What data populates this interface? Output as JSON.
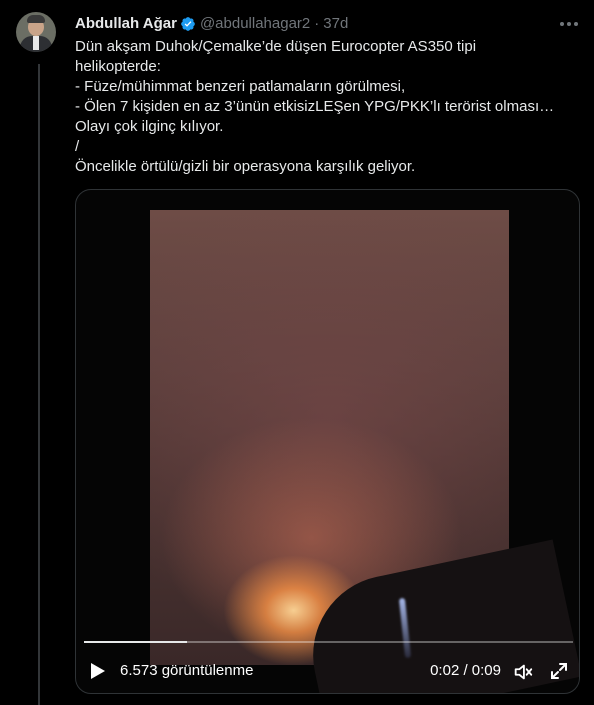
{
  "tweet": {
    "author_name": "Abdullah Ağar",
    "handle": "@abdullahagar2",
    "separator": "·",
    "time": "37d",
    "text_lines": [
      "Dün akşam Duhok/Çemalke’de düşen Eurocopter AS350 tipi",
      "helikopterde:",
      "- Füze/mühimmat benzeri patlamaların görülmesi,",
      "- Ölen 7 kişiden en az 3’ünün etkisizLEŞen YPG/PKK’lı terörist olması…",
      "Olayı çok ilginç kılıyor.",
      "/",
      "Öncelikle örtülü/gizli bir operasyona karşılık geliyor."
    ]
  },
  "video": {
    "views": "6.573 görüntülenme",
    "time_display": "0:02 / 0:09",
    "progress": 0.21
  },
  "colors": {
    "background": "#000000",
    "text_primary": "#e7e9ea",
    "text_secondary": "#71767b",
    "verified_badge": "#1d9bf0"
  },
  "icons": [
    "verified-badge-icon",
    "more-options-icon",
    "play-icon",
    "volume-icon",
    "fullscreen-icon"
  ]
}
